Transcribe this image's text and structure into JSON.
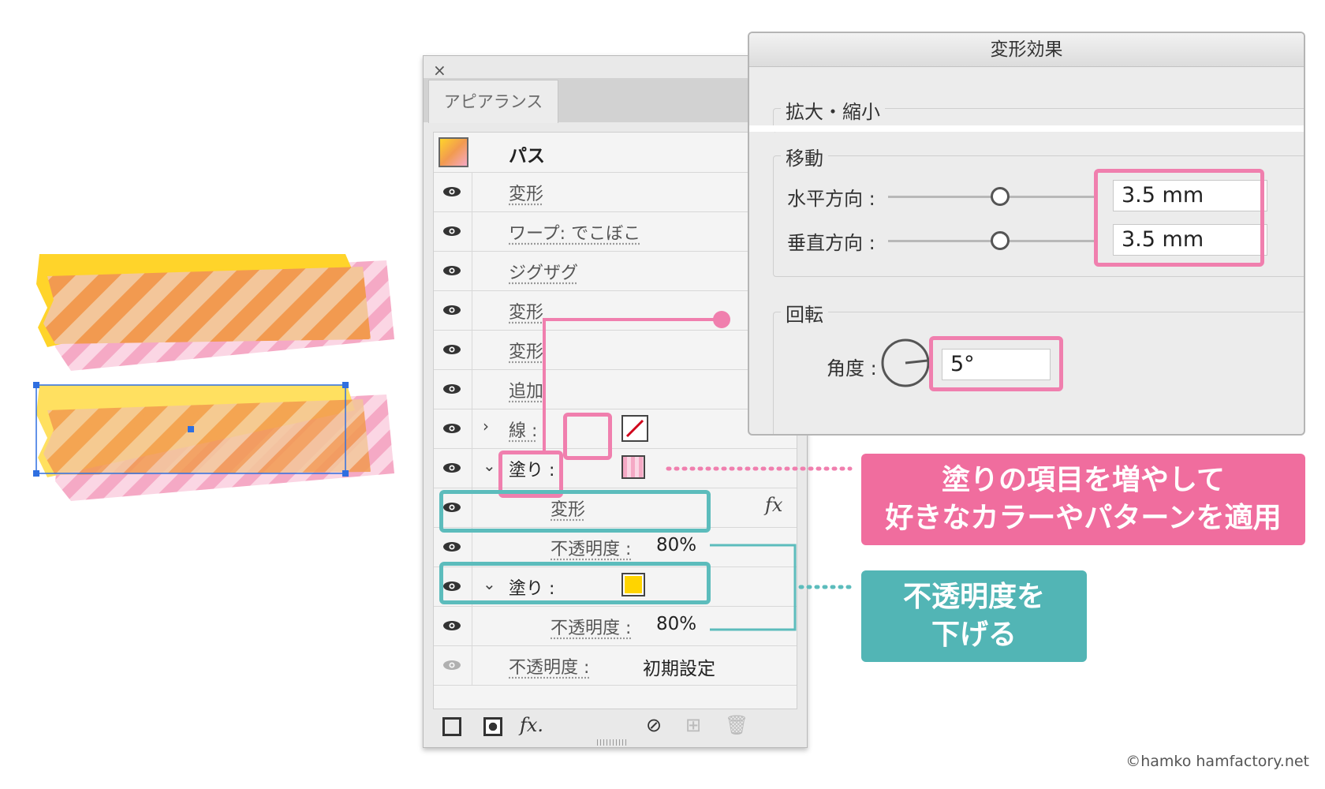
{
  "appearance_panel": {
    "close": "×",
    "tab": "アピアランス",
    "rows": [
      {
        "label": "パス"
      },
      {
        "label": "変形"
      },
      {
        "label": "ワープ: でこぼこ"
      },
      {
        "label": "ジグザグ"
      },
      {
        "label": "変形"
      },
      {
        "label": "変形"
      },
      {
        "label": "追加"
      },
      {
        "label": "線 :"
      },
      {
        "label": "塗り :"
      },
      {
        "label": "変形"
      },
      {
        "label": "不透明度 :",
        "value": "80%"
      },
      {
        "label": "塗り :"
      },
      {
        "label": "不透明度 :",
        "value": "80%"
      },
      {
        "label": "不透明度 :",
        "value": "初期設定"
      }
    ],
    "fx": "fx",
    "toolbar_fx": "fx."
  },
  "dialog": {
    "title": "変形効果",
    "scale_group": "拡大・縮小",
    "move_group": "移動",
    "horizontal_label": "水平方向 :",
    "horizontal_value": "3.5 mm",
    "vertical_label": "垂直方向 :",
    "vertical_value": "3.5 mm",
    "rotate_group": "回転",
    "angle_label": "角度 :",
    "angle_value": "5°"
  },
  "callouts": {
    "pink_line1": "塗りの項目を増やして",
    "pink_line2": "好きなカラーやパターンを適用",
    "teal_line1": "不透明度を",
    "teal_line2": "下げる"
  },
  "copyright": "©hamko  hamfactory.net",
  "colors": {
    "pink": "#f06d9e",
    "teal": "#52b5b5",
    "orange": "#f4a460",
    "yellow": "#ffd42a"
  }
}
